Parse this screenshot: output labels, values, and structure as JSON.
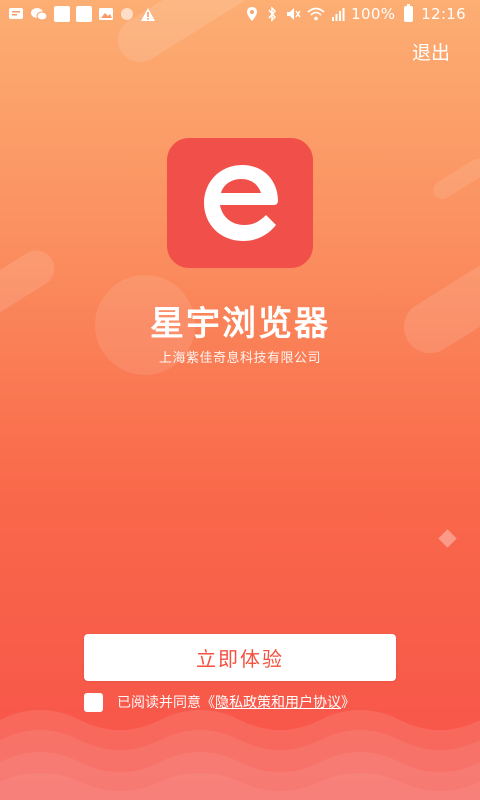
{
  "status_bar": {
    "battery_text": "100%",
    "time": "12:16",
    "left_icons": [
      "message-icon",
      "wechat-icon",
      "notification-icon",
      "notification-icon",
      "image-icon",
      "circle-icon",
      "warning-icon"
    ],
    "right_icons": [
      "location-icon",
      "bluetooth-icon",
      "mute-icon",
      "wifi-icon",
      "signal-icon",
      "battery-icon"
    ]
  },
  "header": {
    "exit_label": "退出"
  },
  "app": {
    "logo_letter": "e",
    "name": "星宇浏览器",
    "company": "上海紫佳奇息科技有限公司"
  },
  "actions": {
    "start_label": "立即体验"
  },
  "agreement": {
    "prefix": "已阅读并同意《",
    "link": "隐私政策和用户协议",
    "suffix": "》"
  },
  "colors": {
    "logo_bg": "#f04f4a",
    "button_text": "#f4513f",
    "gradient_top": "#fcae73",
    "gradient_bottom": "#f7524a"
  }
}
